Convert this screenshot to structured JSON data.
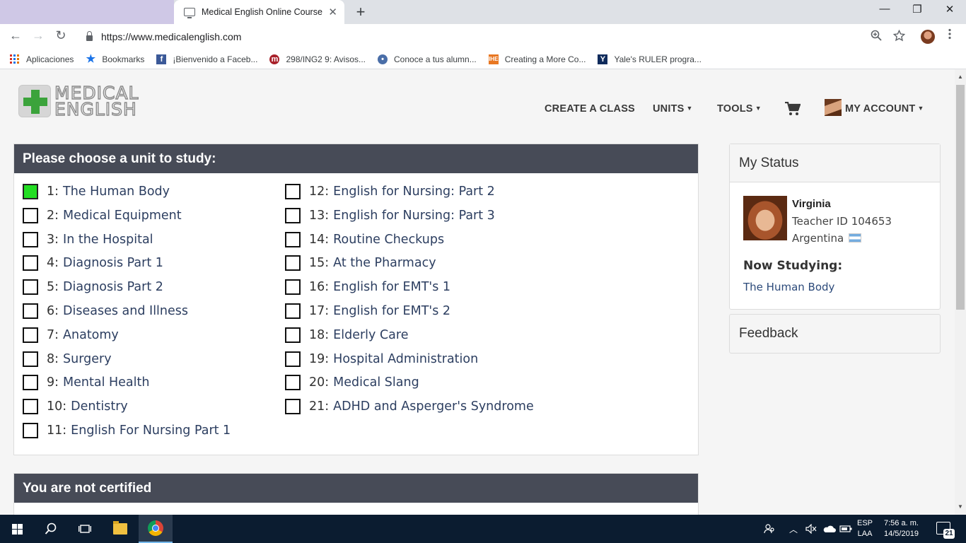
{
  "browser": {
    "tab_title": "Medical English Online Course",
    "tab_close": "✕",
    "new_tab": "+",
    "window_controls": {
      "minimize": "—",
      "restore": "❐",
      "close": "✕"
    },
    "nav": {
      "back": "←",
      "forward": "→",
      "reload": "↻"
    },
    "url": "https://www.medicalenglish.com",
    "zoom_icon": "zoom-icon",
    "star_icon": "bookmark-star-icon"
  },
  "bookmarks": [
    {
      "label": "Aplicaciones",
      "icon": "apps-grid-icon"
    },
    {
      "label": "Bookmarks",
      "icon": "star-icon"
    },
    {
      "label": "¡Bienvenido a Faceb...",
      "icon": "facebook-icon"
    },
    {
      "label": "298/ING2 9: Avisos...",
      "icon": "moodle-icon"
    },
    {
      "label": "Conoce a tus alumn...",
      "icon": "globe-icon"
    },
    {
      "label": "Creating a More Co...",
      "icon": "ihe-icon"
    },
    {
      "label": "Yale's RULER progra...",
      "icon": "yale-icon"
    }
  ],
  "site": {
    "logo": {
      "line1": "MEDICAL",
      "line2": "ENGLISH"
    },
    "nav": {
      "create_class": "CREATE A CLASS",
      "units": "UNITS",
      "tools": "TOOLS",
      "account": "MY ACCOUNT"
    }
  },
  "units_panel": {
    "title": "Please choose a unit to study:",
    "left": [
      {
        "num": "1:",
        "name": "The Human Body",
        "done": true
      },
      {
        "num": "2:",
        "name": "Medical Equipment",
        "done": false
      },
      {
        "num": "3:",
        "name": "In the Hospital",
        "done": false
      },
      {
        "num": "4:",
        "name": "Diagnosis Part 1",
        "done": false
      },
      {
        "num": "5:",
        "name": "Diagnosis Part 2",
        "done": false
      },
      {
        "num": "6:",
        "name": "Diseases and Illness",
        "done": false
      },
      {
        "num": "7:",
        "name": "Anatomy",
        "done": false
      },
      {
        "num": "8:",
        "name": "Surgery",
        "done": false
      },
      {
        "num": "9:",
        "name": "Mental Health",
        "done": false
      },
      {
        "num": "10:",
        "name": "Dentistry",
        "done": false
      },
      {
        "num": "11:",
        "name": "English For Nursing Part 1",
        "done": false
      }
    ],
    "right": [
      {
        "num": "12:",
        "name": "English for Nursing: Part 2",
        "done": false
      },
      {
        "num": "13:",
        "name": "English for Nursing: Part 3",
        "done": false
      },
      {
        "num": "14:",
        "name": "Routine Checkups",
        "done": false
      },
      {
        "num": "15:",
        "name": "At the Pharmacy",
        "done": false
      },
      {
        "num": "16:",
        "name": "English for EMT's 1",
        "done": false
      },
      {
        "num": "17:",
        "name": "English for EMT's 2",
        "done": false
      },
      {
        "num": "18:",
        "name": "Elderly Care",
        "done": false
      },
      {
        "num": "19:",
        "name": "Hospital Administration",
        "done": false
      },
      {
        "num": "20:",
        "name": "Medical Slang",
        "done": false
      },
      {
        "num": "21:",
        "name": "ADHD and Asperger's Syndrome",
        "done": false
      }
    ]
  },
  "cert_panel": {
    "title": "You are not certified"
  },
  "status": {
    "title": "My Status",
    "name": "Virginia",
    "teacher_id": "Teacher ID 104653",
    "country": "Argentina",
    "now_label": "Now Studying:",
    "now_value": "The Human Body"
  },
  "feedback": {
    "title": "Feedback"
  },
  "taskbar": {
    "lang_top": "ESP",
    "lang_bottom": "LAA",
    "time": "7:56 a. m.",
    "date": "14/5/2019",
    "notifications": "21"
  },
  "colors": {
    "panel_header": "#474b57",
    "unit_link": "#2c3e60",
    "completed_check": "#22dd22",
    "logo_green": "#3ba33b"
  }
}
